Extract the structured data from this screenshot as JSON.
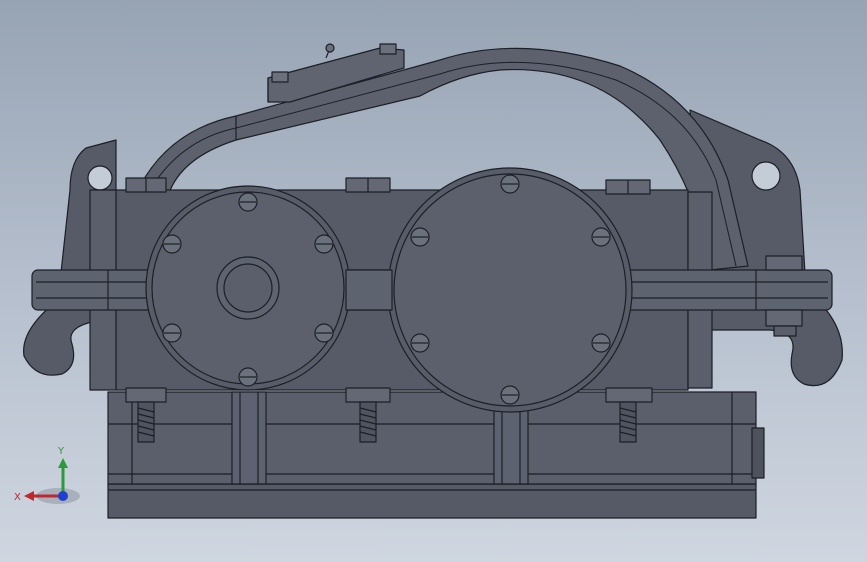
{
  "viewport": {
    "background_top": "#97a4b3",
    "background_bottom": "#cfd6e0"
  },
  "model": {
    "body_color": "#555a66",
    "edge_color": "#1c1f26",
    "highlight_color": "#6a707c"
  },
  "triad": {
    "x_label": "X",
    "y_label": "Y",
    "x_color": "#c0282d",
    "y_color": "#2a9a3a",
    "z_color": "#1f3fd0"
  }
}
